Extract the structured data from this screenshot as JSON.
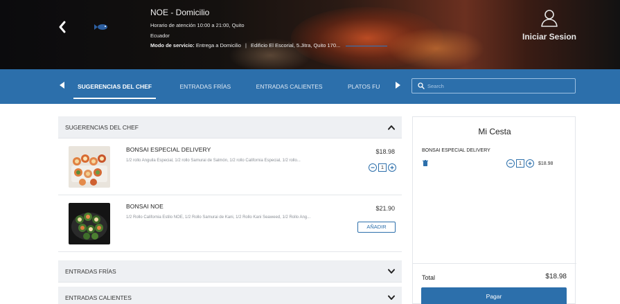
{
  "header": {
    "store_name": "NOE - Domicilio",
    "hours_line1": "Horario de atención 10:00 a 21:00, Quito",
    "hours_line2": "Ecuador",
    "mode_label": "Modo de servicio:",
    "mode_value": "Entrega a Domicilio",
    "separator": "|",
    "address": "Edificio El Escorial, 5.Jitra, Quito 170...",
    "login_label": "Iniciar Sesion",
    "icons": {
      "back": "chevron-left-icon",
      "login": "user-icon",
      "logo": "fish-logo"
    }
  },
  "nav": {
    "tabs": [
      {
        "label": "SUGERENCIAS DEL CHEF",
        "active": true
      },
      {
        "label": "ENTRADAS FRÍAS"
      },
      {
        "label": "ENTRADAS CALIENTES"
      },
      {
        "label": "PLATOS FU"
      }
    ],
    "search_placeholder": "Search",
    "icons": {
      "prev": "caret-left-icon",
      "next": "caret-right-icon",
      "search": "search-icon"
    }
  },
  "menu": {
    "sections": [
      {
        "title": "SUGERENCIAS DEL CHEF",
        "expanded": true,
        "products": [
          {
            "name": "BONSAI ESPECIAL DELIVERY",
            "description": "1/2 rollo Anguila Especial, 1/2 rollo Samurai de Salmón, 1/2 rollo California Especial, 1/2 rollo...",
            "price": "$18.98",
            "quantity": "1",
            "in_cart": true
          },
          {
            "name": "BONSAI NOE",
            "description": "1/2 Rollo California Estilo NOE, 1/2 Rollo Samurai de Kani, 1/2 Rollo Kani Seaweed, 1/2 Rollo Ang...",
            "price": "$21.90",
            "add_label": "AÑADIR",
            "in_cart": false
          }
        ]
      },
      {
        "title": "ENTRADAS FRÍAS",
        "expanded": false
      },
      {
        "title": "ENTRADAS CALIENTES",
        "expanded": false
      }
    ],
    "chevron_up": "⌃",
    "chevron_down": "⌄"
  },
  "basket": {
    "title": "Mi Cesta",
    "items": [
      {
        "name": "BONSAI ESPECIAL DELIVERY",
        "quantity": "1",
        "price": "$18.98"
      }
    ],
    "total_label": "Total",
    "total_value": "$18.98",
    "pay_label": "Pagar"
  },
  "colors": {
    "primary": "#2c6fab",
    "section_bg": "#eef0f3",
    "text": "#333333"
  }
}
